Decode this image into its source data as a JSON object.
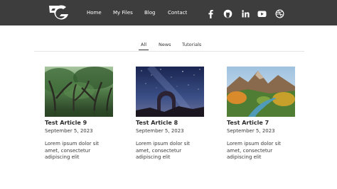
{
  "nav": {
    "home": "Home",
    "my_files": "My Files",
    "blog": "Blog",
    "contact": "Contact"
  },
  "social": [
    "facebook-icon",
    "github-icon",
    "linkedin-icon",
    "youtube-icon",
    "dribbble-icon"
  ],
  "filters": {
    "all": "All",
    "news": "News",
    "tutorials": "Tutorials",
    "active": "All"
  },
  "articles": [
    {
      "title": "Test Article 9",
      "date": "September 5, 2023",
      "excerpt": "Lorem ipsum dolor sit amet, consectetur adipiscing elit",
      "image": "forest-photo"
    },
    {
      "title": "Test Article 8",
      "date": "September 5, 2023",
      "excerpt": "Lorem ipsum dolor sit amet, consectetur adipiscing elit",
      "image": "night-sky-arch-photo"
    },
    {
      "title": "Test Article 7",
      "date": "September 5, 2023",
      "excerpt": "Lorem ipsum dolor sit amet, consectetur adipiscing elit",
      "image": "mountain-valley-photo"
    }
  ],
  "colors": {
    "header_bg": "#3d3d3d",
    "header_text": "#ffffff",
    "body_text": "#333333"
  }
}
